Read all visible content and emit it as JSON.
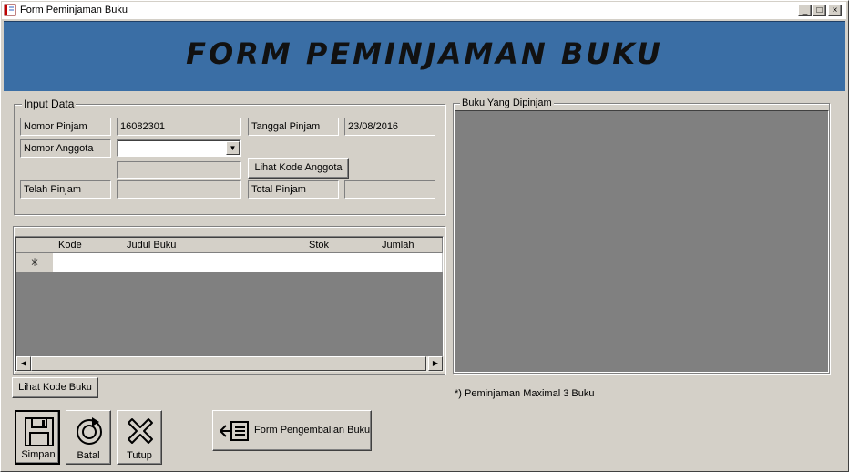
{
  "window": {
    "title": "Form Peminjaman Buku",
    "controls": {
      "minimize": "_",
      "maximize": "□",
      "close": "×"
    }
  },
  "banner": {
    "title": "FORM PEMINJAMAN BUKU",
    "color": "#3a6ea5"
  },
  "input_group": {
    "legend": "Input Data",
    "nomor_pinjam_label": "Nomor Pinjam",
    "nomor_pinjam_value": "16082301",
    "tanggal_pinjam_label": "Tanggal Pinjam",
    "tanggal_pinjam_value": "23/08/2016",
    "nomor_anggota_label": "Nomor Anggota",
    "nomor_anggota_value": "",
    "nama_anggota_value": "",
    "lihat_kode_anggota_label": "Lihat Kode Anggota",
    "telah_pinjam_label": "Telah Pinjam",
    "telah_pinjam_value": "",
    "total_pinjam_label": "Total Pinjam",
    "total_pinjam_value": ""
  },
  "grid": {
    "columns": [
      "Kode",
      "Judul Buku",
      "Stok",
      "Jumlah"
    ],
    "new_row_marker": "✳",
    "rows": []
  },
  "lihat_kode_buku_label": "Lihat Kode Buku",
  "right_panel": {
    "legend": "Buku Yang Dipinjam",
    "note": "*) Peminjaman Maximal 3 Buku"
  },
  "toolbar": {
    "simpan_label": "Simpan",
    "batal_label": "Batal",
    "tutup_label": "Tutup",
    "pengembalian_label": "Form Pengembalian Buku"
  },
  "icons": {
    "app": "book-icon",
    "simpan": "floppy-disk-icon",
    "batal": "refresh-icon",
    "tutup": "x-icon",
    "pengembalian": "arrow-left-list-icon"
  }
}
